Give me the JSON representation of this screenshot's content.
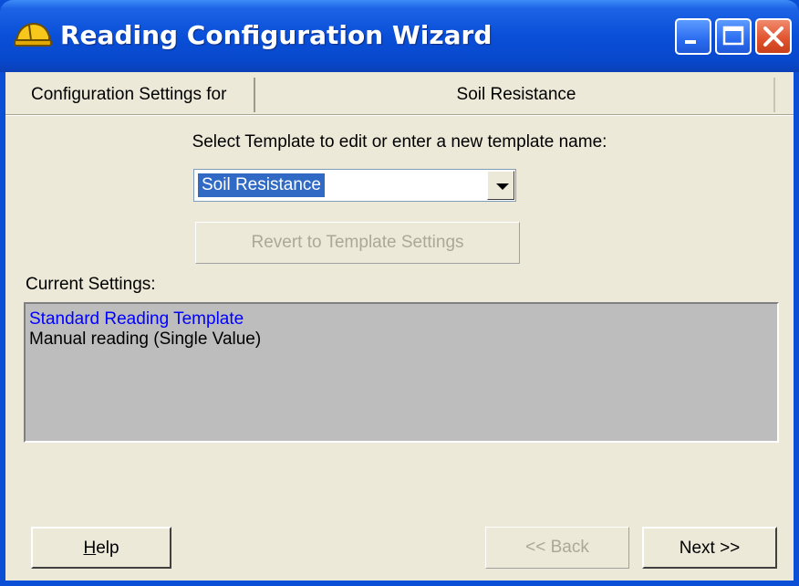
{
  "window": {
    "title": "Reading Configuration Wizard",
    "title_bar_color": "#0a4fd8"
  },
  "config_bar": {
    "label": "Configuration Settings for",
    "value": "Soil Resistance"
  },
  "template": {
    "prompt": "Select Template to edit or enter a new template name:",
    "selected": "Soil Resistance",
    "revert_label": "Revert to Template Settings"
  },
  "current_settings": {
    "label": "Current Settings:",
    "lines": [
      "Standard Reading Template",
      "Manual reading (Single Value)"
    ]
  },
  "buttons": {
    "help_prefix": "H",
    "help_rest": "elp",
    "back": "<< Back",
    "next": "Next >>"
  }
}
